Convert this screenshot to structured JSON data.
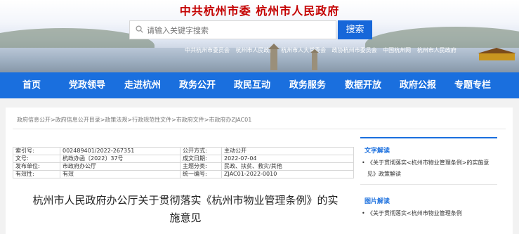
{
  "header": {
    "site_title": "中共杭州市委   杭州市人民政府",
    "search_placeholder": "请输入关键字搜索",
    "search_button": "搜索",
    "quick_links": [
      "中共杭州市委员会",
      "杭州市人民政府",
      "杭州市人大常委会",
      "政协杭州市委员会",
      "中国杭州网",
      "杭州市人民政府"
    ]
  },
  "nav": {
    "items": [
      "首页",
      "党政领导",
      "走进杭州",
      "政务公开",
      "政民互动",
      "政务服务",
      "数据开放",
      "政府公报",
      "专题专栏"
    ]
  },
  "breadcrumb": "政府信息公开>政府信息公开目录>政策法规>行政规范性文件>市政府文件>市政府办ZJAC01",
  "meta": {
    "rows": [
      {
        "k1": "索引号:",
        "v1": "002489401/2022-267351",
        "k2": "公开方式:",
        "v2": "主动公开"
      },
      {
        "k1": "文号:",
        "v1": "杭政办函〔2022〕37号",
        "k2": "成文日期:",
        "v2": "2022-07-04"
      },
      {
        "k1": "发布单位:",
        "v1": "市政府办公厅",
        "k2": "主题分类:",
        "v2": "民政、扶贫、救灾/其他"
      },
      {
        "k1": "有效性:",
        "v1": "有效",
        "k2": "统一编号:",
        "v2": "ZJAC01-2022-0010"
      }
    ]
  },
  "doc_title_line1": "杭州市人民政府办公厅关于贯彻落实《杭州市物业管理条例》的实",
  "doc_title_line2": "施意见",
  "sidebar": {
    "text_heading": "文字解读",
    "text_item": "《关于贯彻落实<杭州市物业管理条例>的实施意见》政策解读",
    "image_heading": "图片解读",
    "image_item": "《关于贯彻落实<杭州市物业管理条例"
  },
  "colors": {
    "nav": "#1a6fde",
    "title_red": "#c40000"
  }
}
